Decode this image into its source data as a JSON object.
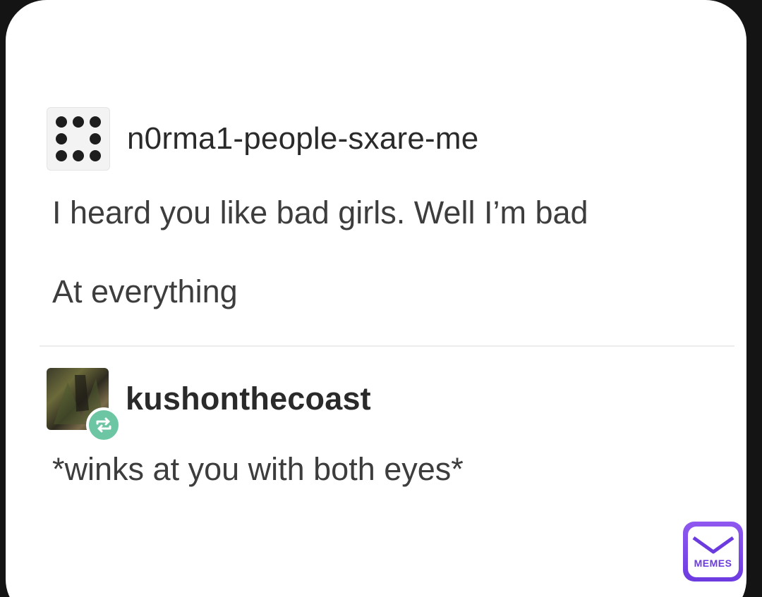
{
  "post": {
    "original_author": "n0rma1-people-sxare-me",
    "original_lines": [
      "I heard you like bad girls. Well I’m bad",
      "At everything"
    ],
    "reblog_author": "kushonthecoast",
    "reblog_text": "*winks at you with both eyes*"
  },
  "watermark": {
    "label": "MEMES"
  },
  "icons": {
    "original_avatar": "dot-grid-avatar-icon",
    "reblog_avatar": "photo-avatar-icon",
    "reblog_badge": "reblog-icon",
    "watermark_logo": "memes-envelope-logo"
  },
  "colors": {
    "card_bg": "#ffffff",
    "outer_bg": "#141414",
    "reblog_badge": "#6cc5a3",
    "memes_purple": "#6c3be0"
  }
}
